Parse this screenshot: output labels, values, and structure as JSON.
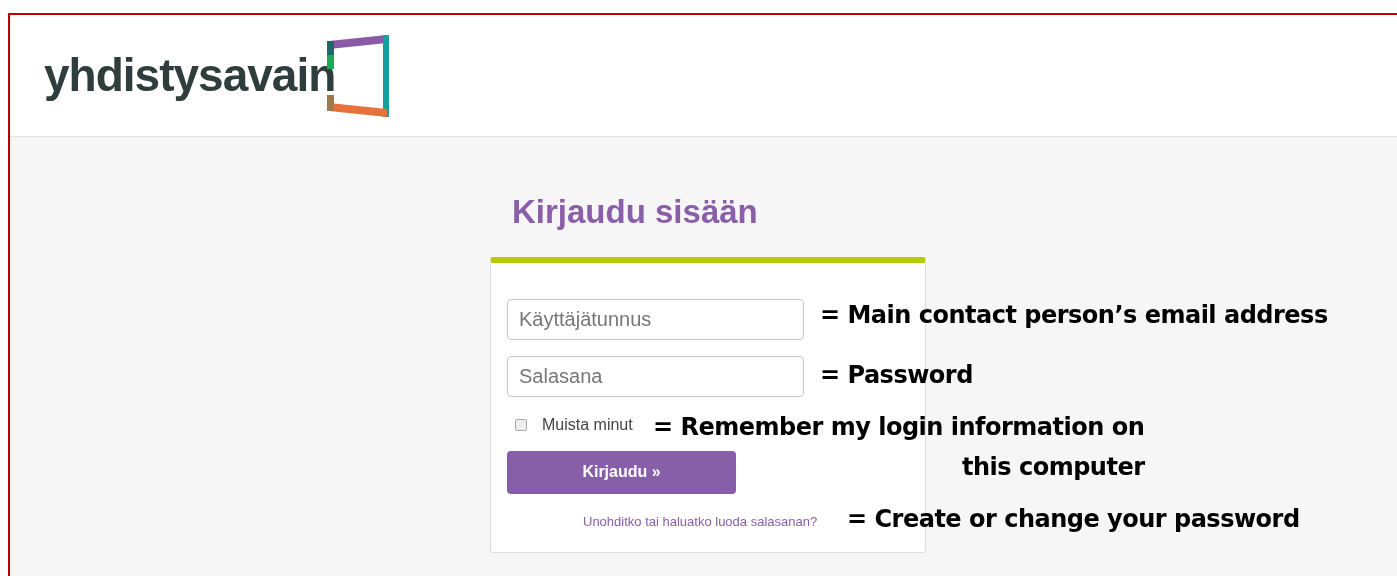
{
  "logo": {
    "text": "yhdistysavain"
  },
  "login": {
    "title": "Kirjaudu sisään",
    "fields": [
      {
        "placeholder": "Käyttäjätunnus"
      },
      {
        "placeholder": "Salasana"
      }
    ],
    "remember": {
      "label": "Muista minut",
      "checked": false
    },
    "submit": "Kirjaudu »",
    "forgot_link": "Unohditko tai haluatko luoda salasanan?"
  },
  "annotations": [
    "= Main contact person’s email address",
    "= Password",
    "= Remember my login information on",
    "this computer",
    "= Create or change your password"
  ]
}
